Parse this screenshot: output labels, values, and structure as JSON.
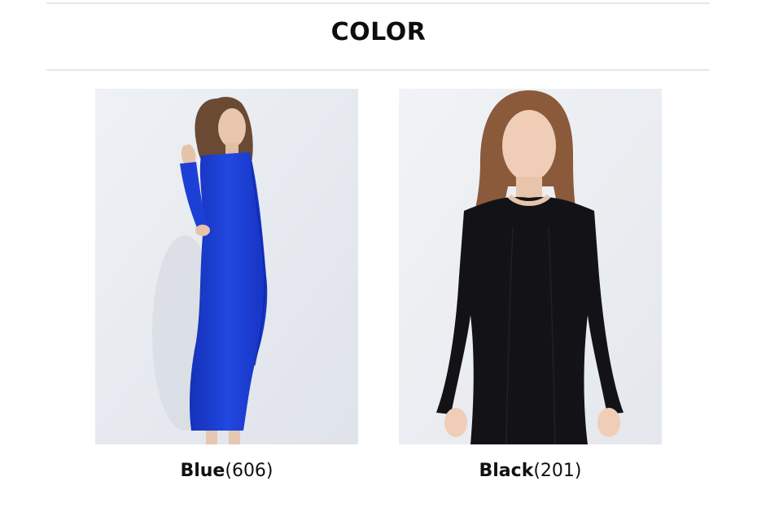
{
  "section": {
    "title": "COLOR"
  },
  "colors": [
    {
      "name": "Blue",
      "count": "(606)",
      "dress_color": "#1a3fd0",
      "background_color": "#e9ecf1",
      "image_icon": "blue-dress-photo"
    },
    {
      "name": "Black",
      "count": "(201)",
      "dress_color": "#141418",
      "background_color": "#eef0f4",
      "image_icon": "black-dress-photo"
    }
  ]
}
